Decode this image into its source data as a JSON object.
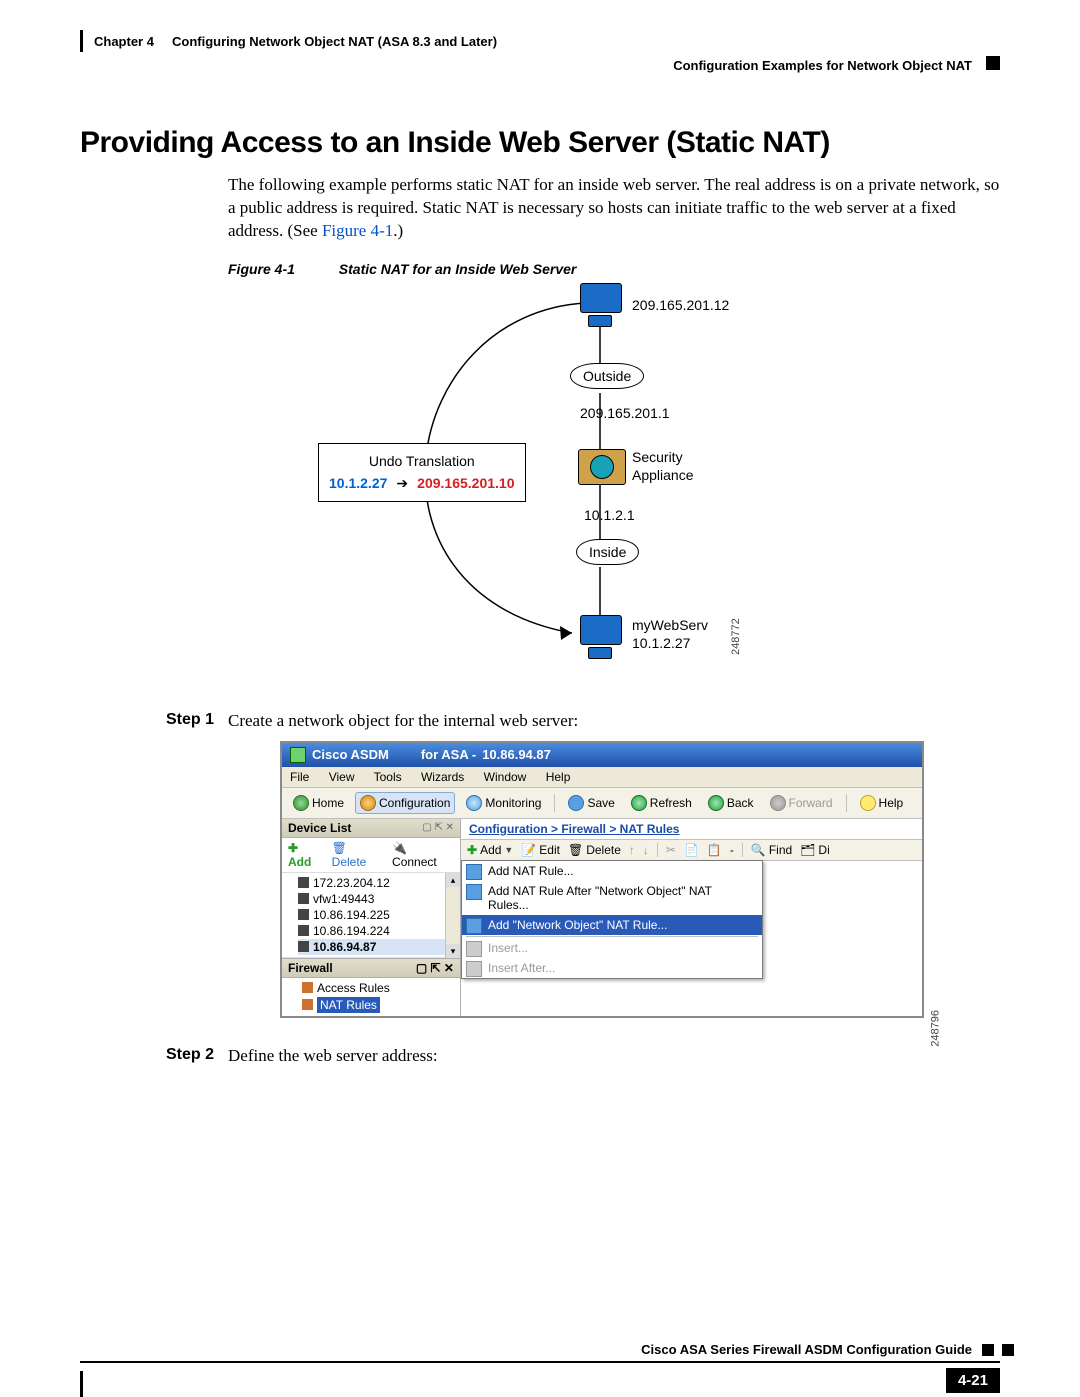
{
  "header": {
    "chapter": "Chapter 4",
    "chapter_title": "Configuring Network Object NAT (ASA 8.3 and Later)",
    "section_right": "Configuration Examples for Network Object NAT"
  },
  "heading": "Providing Access to an Inside Web Server (Static NAT)",
  "intro": "The following example performs static NAT for an inside web server. The real address is on a private network, so a public address is required. Static NAT is necessary so hosts can initiate traffic to the web server at a fixed address. (See ",
  "intro_link": "Figure 4-1",
  "intro_tail": ".)",
  "figure": {
    "number": "Figure 4-1",
    "title": "Static NAT for an Inside Web Server",
    "client_ip": "209.165.201.12",
    "outside_label": "Outside",
    "outside_gw_ip": "209.165.201.1",
    "appliance_label1": "Security",
    "appliance_label2": "Appliance",
    "inside_gw_ip": "10.1.2.1",
    "inside_label": "Inside",
    "server_label": "myWebServ",
    "server_ip": "10.1.2.27",
    "undo_title": "Undo Translation",
    "undo_src": "10.1.2.27",
    "undo_dst": "209.165.201.10",
    "fig_id": "248772"
  },
  "steps": {
    "step1_label": "Step 1",
    "step1_text": "Create a network object for the internal web server:",
    "step2_label": "Step 2",
    "step2_text": "Define the web server address:"
  },
  "asdm": {
    "title_prefix": "Cisco ASDM",
    "title_mid": "for ASA -",
    "title_ip": "10.86.94.87",
    "menubar": [
      "File",
      "View",
      "Tools",
      "Wizards",
      "Window",
      "Help"
    ],
    "toolbar": {
      "home": "Home",
      "configuration": "Configuration",
      "monitoring": "Monitoring",
      "save": "Save",
      "refresh": "Refresh",
      "back": "Back",
      "forward": "Forward",
      "help": "Help"
    },
    "left": {
      "devicelist_title": "Device List",
      "add": "Add",
      "delete": "Delete",
      "connect": "Connect",
      "hosts": [
        "172.23.204.12",
        "vfw1:49443",
        "10.86.194.225",
        "10.86.194.224",
        "10.86.94.87"
      ],
      "firewall_title": "Firewall",
      "firewall_items": [
        "Access Rules",
        "NAT Rules"
      ]
    },
    "right": {
      "breadcrumb": "Configuration > Firewall > NAT Rules",
      "add": "Add",
      "edit": "Edit",
      "delete": "Delete",
      "find": "Find",
      "di": "Di",
      "menu": {
        "item1": "Add NAT Rule...",
        "item2": "Add NAT Rule After \"Network Object\" NAT Rules...",
        "item3": "Add \"Network Object\" NAT Rule...",
        "item4": "Insert...",
        "item5": "Insert After..."
      }
    },
    "fig_id": "248796"
  },
  "footer": {
    "guide": "Cisco ASA Series Firewall ASDM Configuration Guide",
    "page": "4-21"
  }
}
